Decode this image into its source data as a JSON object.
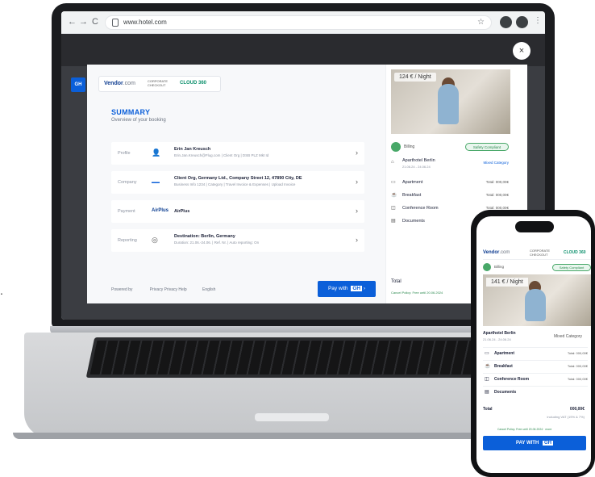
{
  "browser": {
    "url": "www.hotel.com",
    "back": "←",
    "forward": "→",
    "reload": "C",
    "profile1": "",
    "profile2": "",
    "menu": "⋮",
    "close": "×"
  },
  "side_logo": "GH",
  "booking": {
    "brand": "Vendor",
    "brand_suffix": ".com",
    "brand_tag": "CORPORATE CHECKOUT",
    "brand_partner": "CLOUD 360",
    "summary_title": "SUMMARY",
    "summary_sub": "Overview of your booking",
    "rows": [
      {
        "label": "Profile",
        "icon": "person-icon",
        "main": "Erin Jan Kreusch",
        "sub": "Erin.Jan.Kreusch@Flug.com | Client Org | DSB PLZ Mkt Id"
      },
      {
        "label": "Company",
        "icon": "company-logo",
        "main": "Client Org, Germany Ltd., Company Street 12, 47890 City, DE",
        "sub": "Business Info 1234 | Category | Travel Invoice & Expenses | Upload Invoice"
      },
      {
        "label": "Payment",
        "icon": "airplus-logo",
        "main": "AirPlus",
        "sub": ""
      },
      {
        "label": "Reporting",
        "icon": "reporting-icon",
        "main": "Destination: Berlin, Germany",
        "sub": "Duration: 21.06.-24.06. | Ref. Nr. | Auto reporting: On"
      }
    ],
    "footer_powered": "Powered by",
    "footer_links": "Privacy  Privacy  Help",
    "footer_lang": "English",
    "pay_button": "Pay with",
    "pay_brand": "GH"
  },
  "hotel_panel": {
    "price": "124 € / Night",
    "eco_label": "Billing",
    "eco_badge": "Safety Compliant",
    "hotel_name": "Aparthotel Berlin",
    "hotel_dates": "21.06.24 - 24.06.24",
    "hotel_cat": "Mixed Category",
    "items": [
      {
        "icon": "bed-icon",
        "label": "Apartment",
        "value": "Total: 000,00€"
      },
      {
        "icon": "coffee-icon",
        "label": "Breakfast",
        "value": "Total: 000,00€"
      },
      {
        "icon": "meeting-icon",
        "label": "Conference Room",
        "value": "Total: 000,00€"
      },
      {
        "icon": "document-icon",
        "label": "Documents",
        "value": ""
      }
    ],
    "total_label": "Total",
    "total_note": "Cancel Policy: Free until 20.06.2024"
  },
  "phone": {
    "brand": "Vendor",
    "brand_suffix": ".com",
    "brand_tag": "CORPORATE CHECKOUT",
    "brand_partner": "CLOUD 360",
    "eco_label": "Billing",
    "eco_badge": "Safety Compliant",
    "price": "141 € / Night",
    "hotel_name": "Aparthotel Berlin",
    "hotel_dates": "21.06.24 - 24.06.24",
    "hotel_cat": "Mixed Category",
    "items": [
      {
        "icon": "bed-icon",
        "label": "Apartment",
        "value": "Total: 000,00€"
      },
      {
        "icon": "coffee-icon",
        "label": "Breakfast",
        "value": "Total: 000,00€"
      },
      {
        "icon": "meeting-icon",
        "label": "Conference Room",
        "value": "Total: 000,00€"
      },
      {
        "icon": "document-icon",
        "label": "Documents",
        "value": ""
      }
    ],
    "total_label": "Total",
    "total_value": "000,00€",
    "vat": "including VAT (19% & 7%)",
    "note": "Cancel Policy: Free until 20.06.2024 · more",
    "pay_button": "PAY WITH",
    "pay_brand": "GH"
  }
}
